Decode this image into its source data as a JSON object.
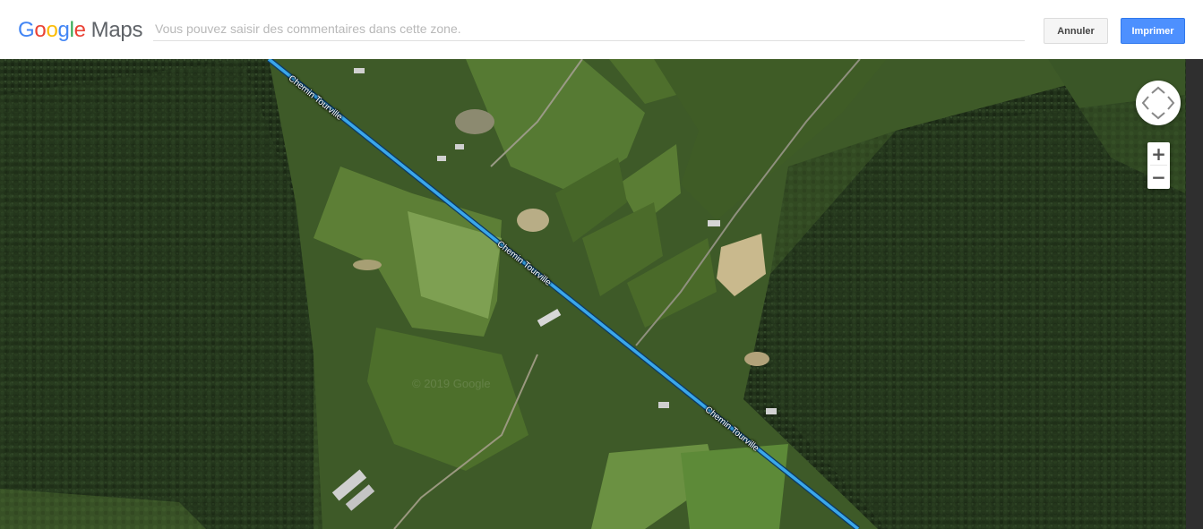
{
  "header": {
    "logo": {
      "g1": "G",
      "g2": "o",
      "g3": "o",
      "g4": "g",
      "g5": "l",
      "g6": "e",
      "maps": "Maps"
    },
    "comment_placeholder": "Vous pouvez saisir des commentaires dans cette zone.",
    "cancel_label": "Annuler",
    "print_label": "Imprimer"
  },
  "map": {
    "road_name": "Chemin Tourville",
    "watermark": "© 2019 Google",
    "zoom_in": "+",
    "zoom_out": "−",
    "icons": {
      "pan": "pan-arrows-icon",
      "zoom_in": "plus-icon",
      "zoom_out": "minus-icon"
    },
    "colors": {
      "route": "#3aa7ea",
      "forest": "#1f2e18",
      "field": "#4f6e2d",
      "accent": "#4d90fe"
    }
  }
}
